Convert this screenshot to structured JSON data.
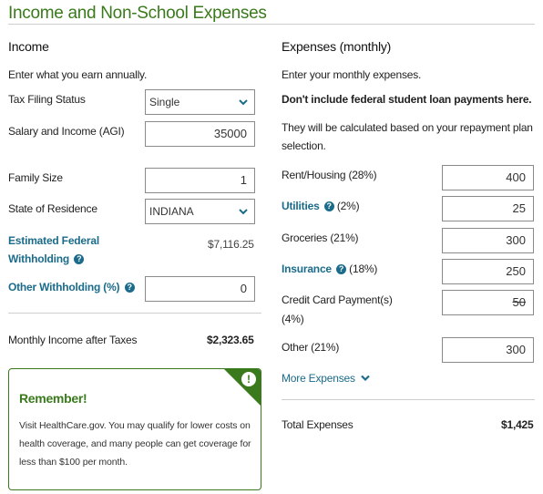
{
  "page": {
    "title": "Income and Non-School Expenses"
  },
  "income": {
    "heading": "Income",
    "intro": "Enter what you earn annually.",
    "filing_status": {
      "label": "Tax Filing Status",
      "value": "Single"
    },
    "salary": {
      "label": "Salary and Income (AGI)",
      "value": "35000"
    },
    "family_size": {
      "label": "Family Size",
      "value": "1"
    },
    "state": {
      "label": "State of Residence",
      "value": "INDIANA"
    },
    "federal_withholding": {
      "label_line1": "Estimated Federal",
      "label_line2": "Withholding",
      "value": "$7,116.25"
    },
    "other_withholding": {
      "label": "Other Withholding (%)",
      "value": "0"
    },
    "monthly_income": {
      "label": "Monthly Income after Taxes",
      "value": "$2,323.65"
    }
  },
  "remember": {
    "title": "Remember!",
    "body": "Visit HealthCare.gov. You may qualify for lower costs on health coverage, and many people can get coverage for less than $100 per month.",
    "icon": "exclamation-icon"
  },
  "expenses": {
    "heading": "Expenses (monthly)",
    "intro": "Enter your monthly expenses.",
    "note_bold": "Don't include federal student loan payments here.",
    "note": "They will be calculated based on your repayment plan selection.",
    "rent": {
      "label": "Rent/Housing (28%)",
      "value": "400"
    },
    "utilities": {
      "label": "Utilities",
      "pct": "(2%)",
      "value": "25"
    },
    "groceries": {
      "label": "Groceries (21%)",
      "value": "300"
    },
    "insurance": {
      "label": "Insurance",
      "pct": "(18%)",
      "value": "250"
    },
    "credit_card": {
      "label_line1": "Credit Card Payment(s)",
      "label_line2": "(4%)",
      "value": "50"
    },
    "other": {
      "label": "Other (21%)",
      "value": "300"
    },
    "more_link": "More Expenses",
    "total": {
      "label": "Total Expenses",
      "value": "$1,425"
    }
  },
  "colors": {
    "accent_green": "#3a7a1c",
    "link_blue": "#1b6b8a"
  }
}
